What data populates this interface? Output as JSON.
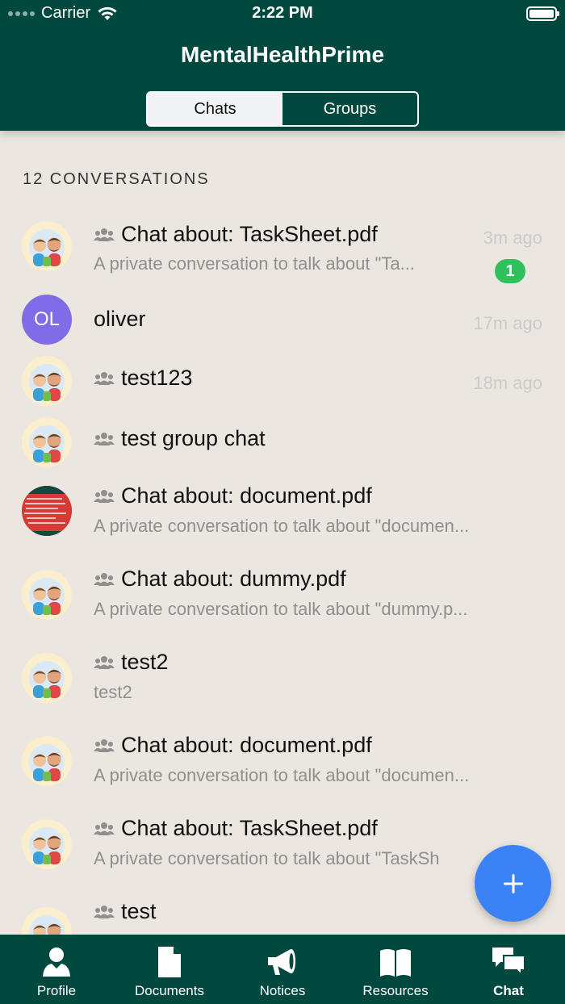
{
  "status_bar": {
    "carrier": "Carrier",
    "time": "2:22 PM"
  },
  "header": {
    "title": "MentalHealthPrime",
    "segments": [
      {
        "label": "Chats",
        "active": true
      },
      {
        "label": "Groups",
        "active": false
      }
    ]
  },
  "section_title": "12 CONVERSATIONS",
  "conversations": [
    {
      "title": "Chat about: TaskSheet.pdf",
      "subtitle": "A private conversation to talk about \"Ta...",
      "time": "3m ago",
      "badge": "1",
      "avatar": "group-avatar-icon",
      "group": true
    },
    {
      "title": "oliver",
      "subtitle": "",
      "time": "17m ago",
      "avatar_initials": "OL",
      "group": false
    },
    {
      "title": "test123",
      "subtitle": "",
      "time": "18m ago",
      "avatar": "group-avatar-icon",
      "group": true
    },
    {
      "title": "test group chat",
      "subtitle": "",
      "time": "",
      "avatar": "group-avatar-icon",
      "group": true
    },
    {
      "title": "Chat about: document.pdf",
      "subtitle": "A private conversation to talk about \"documen...",
      "time": "",
      "avatar": "document-thumbnail",
      "group": true
    },
    {
      "title": "Chat about: dummy.pdf",
      "subtitle": "A private conversation to talk about \"dummy.p...",
      "time": "",
      "avatar": "group-avatar-icon",
      "group": true
    },
    {
      "title": "test2",
      "subtitle": "test2",
      "time": "",
      "avatar": "group-avatar-icon",
      "group": true
    },
    {
      "title": "Chat about: document.pdf",
      "subtitle": "A private conversation to talk about \"documen...",
      "time": "",
      "avatar": "group-avatar-icon",
      "group": true
    },
    {
      "title": "Chat about: TaskSheet.pdf",
      "subtitle": "A private conversation to talk about \"TaskSh",
      "time": "",
      "avatar": "group-avatar-icon",
      "group": true
    },
    {
      "title": "test",
      "subtitle": "",
      "time": "",
      "avatar": "group-avatar-icon",
      "group": true
    }
  ],
  "fab": {
    "icon": "plus-icon"
  },
  "tabbar": [
    {
      "label": "Profile",
      "icon": "person-icon",
      "active": false
    },
    {
      "label": "Documents",
      "icon": "document-icon",
      "active": false
    },
    {
      "label": "Notices",
      "icon": "megaphone-icon",
      "active": false
    },
    {
      "label": "Resources",
      "icon": "book-icon",
      "active": false
    },
    {
      "label": "Chat",
      "icon": "chat-bubbles-icon",
      "active": true
    }
  ],
  "colors": {
    "header": "#01493f",
    "background": "#ece6e0",
    "fab": "#3b82f6",
    "badge": "#2ec05a",
    "initials_avatar": "#7f6ce6"
  }
}
